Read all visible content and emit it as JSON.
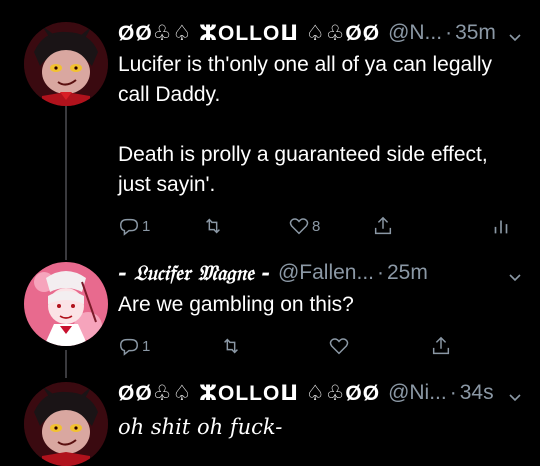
{
  "tweets": [
    {
      "display_name": "ØØ♧♤ ⵣOLLOⵡ ♤♧ØØ",
      "handle": "@N...",
      "separator": "·",
      "time": "35m",
      "text": "Lucifer is th'only one all of ya can legally call Daddy.\n\nDeath is prolly a guaranteed side effect, just sayin'.",
      "reply_count": "1",
      "retweet_count": "",
      "like_count": "8"
    },
    {
      "display_name": "- 𝔏𝔲𝔠𝔦𝔣𝔢𝔯 𝔐𝔞𝔤𝔫𝔢 -",
      "handle": "@Fallen...",
      "separator": "·",
      "time": "25m",
      "text": "Are we gambling on this?",
      "reply_count": "1",
      "retweet_count": "",
      "like_count": ""
    },
    {
      "display_name": "ØØ♧♤ ⵣOLLOⵡ ♤♧ØØ",
      "handle": "@Ni...",
      "separator": "·",
      "time": "34s",
      "text": "oh shit oh fuck-"
    }
  ],
  "icons": {
    "reply": "reply-icon",
    "retweet": "retweet-icon",
    "like": "heart-icon",
    "share": "share-icon",
    "analytics": "analytics-icon",
    "menu": "chevron-down-icon"
  },
  "colors": {
    "background": "#000000",
    "text": "#ffffff",
    "secondary": "#8b98a5",
    "thread_line": "#3a3a3e"
  }
}
